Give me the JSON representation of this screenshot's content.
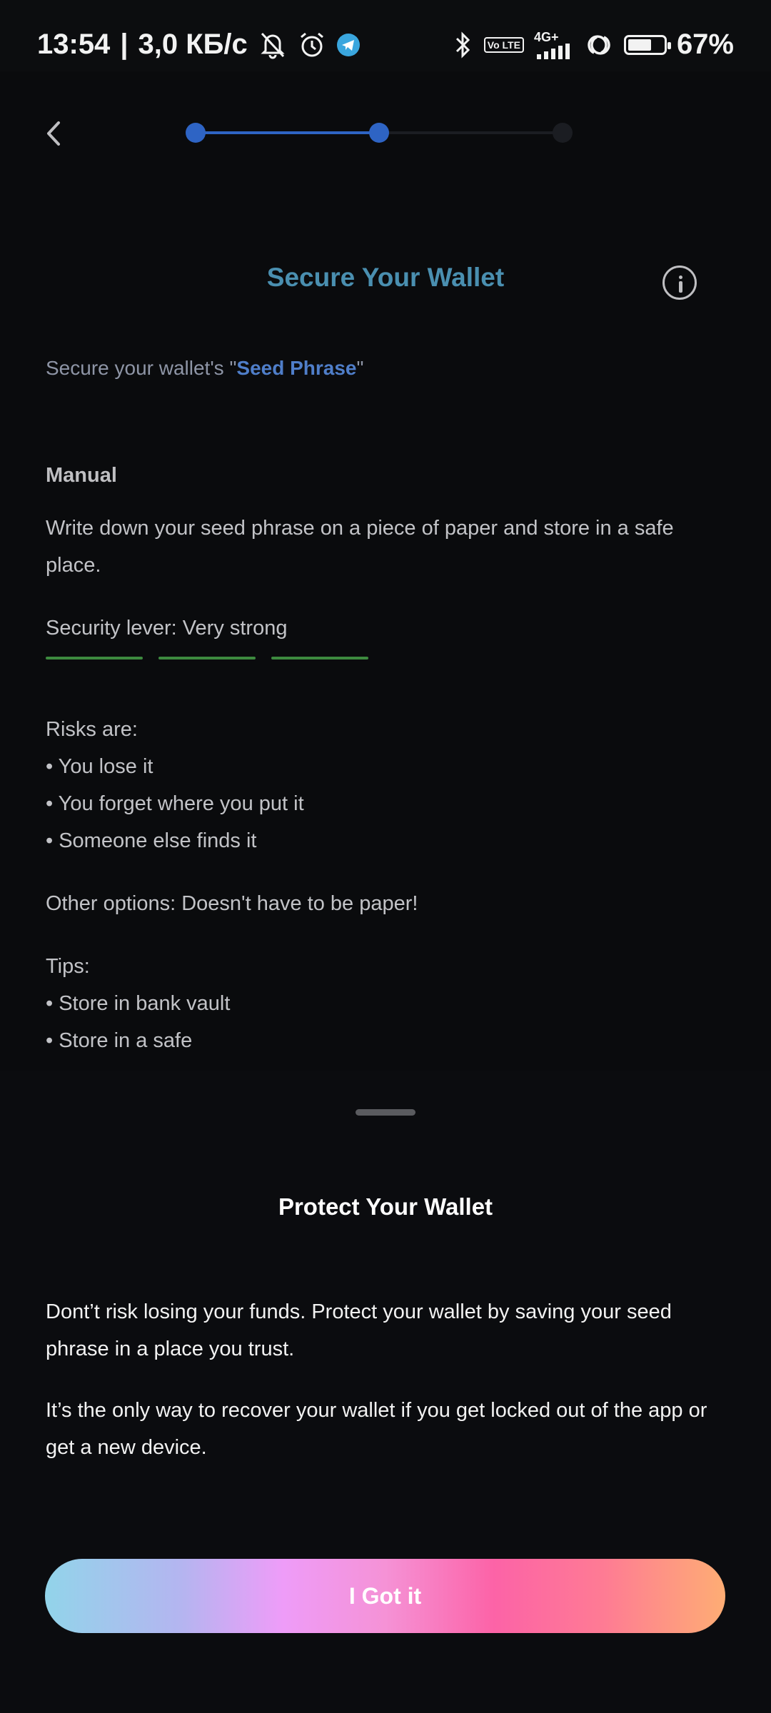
{
  "status_bar": {
    "time": "13:54",
    "separator": "|",
    "speed": "3,0 КБ/с",
    "network_type": "4G+",
    "volte_label": "Vo LTE",
    "battery_percent": "67%",
    "battery_level": 0.67,
    "icons": [
      "muted-bell-icon",
      "alarm-icon",
      "telegram-icon",
      "bluetooth-icon",
      "volte-icon",
      "signal-icon",
      "hotspot-icon",
      "battery-icon"
    ]
  },
  "nav": {
    "back_icon": "chevron-left-icon",
    "steps_total": 3,
    "steps_completed": 2,
    "colors": {
      "active": "#2e64c4",
      "inactive": "#1b1d22"
    }
  },
  "header": {
    "title": "Secure Your Wallet",
    "info_icon": "info-icon",
    "title_color": "#4a8fb0"
  },
  "subtitle": {
    "prefix": "Secure your wallet's \"",
    "highlight": "Seed Phrase",
    "suffix": "\""
  },
  "manual": {
    "heading": "Manual",
    "description": "Write down your seed phrase on a piece of paper and store in a safe place.",
    "security_label": "Security lever: Very strong",
    "security_level": 3,
    "security_max": 3,
    "security_color": "#3d8a3f",
    "risks_title": "Risks are:",
    "risks": [
      "• You lose it",
      "• You forget where you put it",
      "• Someone else finds it"
    ],
    "other_options": "Other options: Doesn't have to be paper!",
    "tips_title": "Tips:",
    "tips": [
      "• Store in bank vault",
      "• Store in a safe"
    ]
  },
  "sheet": {
    "title": "Protect Your Wallet",
    "paragraph1": "Dont’t risk losing your funds. Protect your wallet by saving your seed phrase in a place you trust.",
    "paragraph2": "It’s the only way to recover your wallet if you get locked out of the app or get a new device.",
    "button_label": "I Got it"
  }
}
